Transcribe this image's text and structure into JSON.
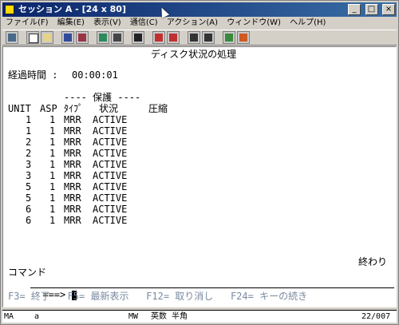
{
  "window": {
    "title": "セッション A - [24 x 80]",
    "buttons": [
      "_",
      "□",
      "×"
    ]
  },
  "menu": [
    "ファイル(F)",
    "編集(E)",
    "表示(V)",
    "通信(C)",
    "アクション(A)",
    "ウィンドウ(W)",
    "ヘルプ(H)"
  ],
  "toolbar": {
    "icons": [
      "print-screen-icon",
      "copy-icon",
      "paste-icon",
      "send-icon",
      "receive-icon",
      "display-icon",
      "macro-icon",
      "record-icon",
      "stop-icon",
      "play-icon",
      "keypad-icon",
      "palette-icon",
      "customize-icon"
    ]
  },
  "screen": {
    "heading": "ディスク状況の処理",
    "elapsed_label": "経過時間 :",
    "elapsed_value": "00:00:01",
    "protect_header": "---- 保護 ----",
    "columns": {
      "unit": "UNIT",
      "asp": "ASP",
      "type": "ﾀｲﾌﾟ",
      "status": "状況",
      "compression": "圧縮"
    },
    "rows": [
      {
        "unit": "1",
        "asp": "1",
        "type": "MRR",
        "status": "ACTIVE"
      },
      {
        "unit": "1",
        "asp": "1",
        "type": "MRR",
        "status": "ACTIVE"
      },
      {
        "unit": "2",
        "asp": "1",
        "type": "MRR",
        "status": "ACTIVE"
      },
      {
        "unit": "2",
        "asp": "1",
        "type": "MRR",
        "status": "ACTIVE"
      },
      {
        "unit": "3",
        "asp": "1",
        "type": "MRR",
        "status": "ACTIVE"
      },
      {
        "unit": "3",
        "asp": "1",
        "type": "MRR",
        "status": "ACTIVE"
      },
      {
        "unit": "5",
        "asp": "1",
        "type": "MRR",
        "status": "ACTIVE"
      },
      {
        "unit": "5",
        "asp": "1",
        "type": "MRR",
        "status": "ACTIVE"
      },
      {
        "unit": "6",
        "asp": "1",
        "type": "MRR",
        "status": "ACTIVE"
      },
      {
        "unit": "6",
        "asp": "1",
        "type": "MRR",
        "status": "ACTIVE"
      }
    ],
    "end_label": "終わり",
    "command_label": "コマンド",
    "command_prompt": "===>",
    "function_keys": "F3= 終了   F5= 最新表示   F12= 取り消し   F24= キーの続き"
  },
  "status_bar": {
    "indicator": "MA",
    "session": "a",
    "mode": "MW",
    "input_mode": "英数 半角",
    "cursor_pos": "22/007"
  }
}
